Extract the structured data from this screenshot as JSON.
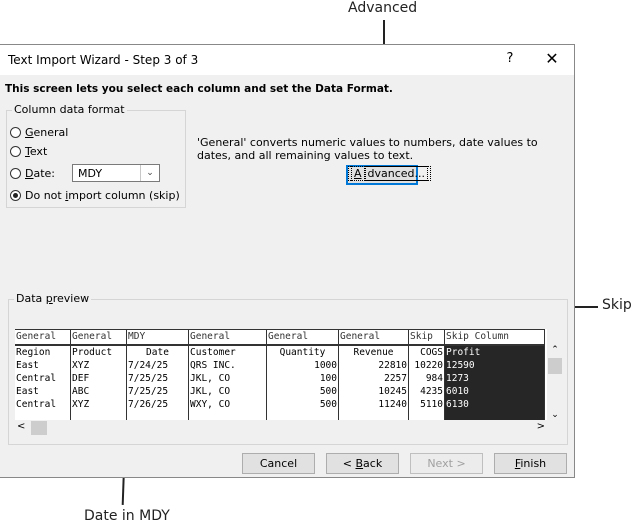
{
  "callouts": {
    "advanced": "Advanced",
    "skip": "Skip",
    "date": "Date in MDY"
  },
  "dialog": {
    "title": "Text Import Wizard - Step 3 of 3",
    "help_label": "?",
    "close_label": "✕",
    "intro": "This screen lets you select each column and set the Data Format.",
    "column_format": {
      "legend": "Column data format",
      "options": [
        {
          "label_u": "G",
          "label_rest": "eneral",
          "selected": false
        },
        {
          "label_u": "T",
          "label_rest": "ext",
          "selected": false
        },
        {
          "label_u": "D",
          "label_rest": "ate:",
          "selected": false
        },
        {
          "label_pre": "Do not ",
          "label_u": "i",
          "label_rest": "mport column (skip)",
          "selected": true
        }
      ],
      "date_format": "MDY"
    },
    "description": "'General' converts numeric values to numbers, date values to dates, and all remaining values to text.",
    "advanced_button": {
      "u": "A",
      "rest": "dvanced..."
    },
    "preview": {
      "legend_pre": "Data ",
      "legend_u": "p",
      "legend_rest": "review",
      "columns": [
        {
          "header": "General",
          "cells": [
            "Region",
            "East",
            "Central",
            "East",
            "Central"
          ]
        },
        {
          "header": "General",
          "cells": [
            "Product",
            "XYZ",
            "DEF",
            "ABC",
            "XYZ"
          ]
        },
        {
          "header": "MDY",
          "cells": [
            "Date",
            "7/24/25",
            "7/25/25",
            "7/25/25",
            "7/26/25"
          ]
        },
        {
          "header": "General",
          "cells": [
            "Customer",
            "QRS INC.",
            "JKL, CO",
            "JKL, CO",
            "WXY, CO"
          ]
        },
        {
          "header": "General",
          "cells": [
            "Quantity",
            "1000",
            "100",
            "500",
            "500"
          ]
        },
        {
          "header": "General",
          "cells": [
            "Revenue",
            "22810",
            "2257",
            "10245",
            "11240"
          ]
        },
        {
          "header": "Skip",
          "cells": [
            "COGS",
            "10220",
            "984",
            "4235",
            "5110"
          ]
        },
        {
          "header": "Skip Column",
          "cells": [
            "Profit",
            "12590",
            "1273",
            "6010",
            "6130"
          ]
        }
      ]
    },
    "buttons": {
      "cancel": "Cancel",
      "back_pre": "< ",
      "back_u": "B",
      "back_rest": "ack",
      "next": "Next >",
      "finish_u": "F",
      "finish_rest": "inish"
    }
  }
}
